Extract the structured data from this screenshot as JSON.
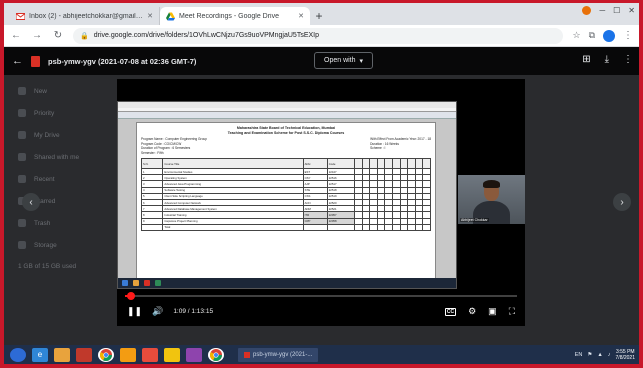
{
  "browser": {
    "tabs": [
      {
        "title": "Inbox (2) - abhijeetchokkar@gmail.com",
        "favicon_color": "#d93025"
      },
      {
        "title": "Meet Recordings - Google Drive",
        "favicon_color": "#188038"
      }
    ],
    "address": "drive.google.com/drive/folders/1OVhLwCNjzu7Gs9uoVPMngjaU5TsEXIp"
  },
  "viewer": {
    "file_name": "psb-ymw-ygv (2021-07-08 at 02:36 GMT-7)",
    "open_with_label": "Open with"
  },
  "drive_sidebar": [
    "New",
    "Priority",
    "My Drive",
    "Shared with me",
    "Recent",
    "Starred",
    "Trash",
    "Storage",
    "1 GB of 15 GB used"
  ],
  "document": {
    "heading1": "Maharashtra State Board of Technical Education, Mumbai",
    "heading2": "Teaching and Examination Scheme for Post S.S.C. Diploma Courses",
    "left_info": [
      "Program Name : Computer Engineering Group",
      "Program Code : CO/CM/CW",
      "Duration of Program : 6 Semesters",
      "Semester : Fifth"
    ],
    "right_info": [
      "With Effect From Academic Year: 2017 - 18",
      "Duration : 16 Weeks",
      "Scheme : I"
    ],
    "rows": [
      {
        "sn": "1",
        "title": "Environmental Studies",
        "abbr": "EST",
        "code": "22447"
      },
      {
        "sn": "2",
        "title": "Operating System",
        "abbr": "OSY",
        "code": "22516"
      },
      {
        "sn": "3",
        "title": "Advanced Java Programming",
        "abbr": "AJP",
        "code": "22517"
      },
      {
        "sn": "4",
        "title": "Software Testing",
        "abbr": "STE",
        "code": "22518"
      },
      {
        "sn": "5",
        "title": "Client Side Scripting Language",
        "abbr": "CSS",
        "code": "22519"
      },
      {
        "sn": "6",
        "title": "Advanced Computer Network",
        "abbr": "ACN",
        "code": "22520"
      },
      {
        "sn": "7",
        "title": "Advanced Database Management System",
        "abbr": "ADM",
        "code": "22521"
      },
      {
        "sn": "8",
        "title": "Industrial Training",
        "abbr": "ITR",
        "code": "22057"
      },
      {
        "sn": "9",
        "title": "Capstone Project Planning",
        "abbr": "CPP",
        "code": "22058"
      }
    ],
    "total_label": "Total"
  },
  "camera": {
    "name": "Abhijeet Chokkar"
  },
  "player": {
    "current_time": "1:09",
    "duration": "1:13:15",
    "progress": 0.016
  },
  "taskbar": {
    "item_label": "psb-ymw-ygv (2021-...",
    "lang": "EN",
    "time": "3:55 PM",
    "date": "7/8/2021"
  }
}
